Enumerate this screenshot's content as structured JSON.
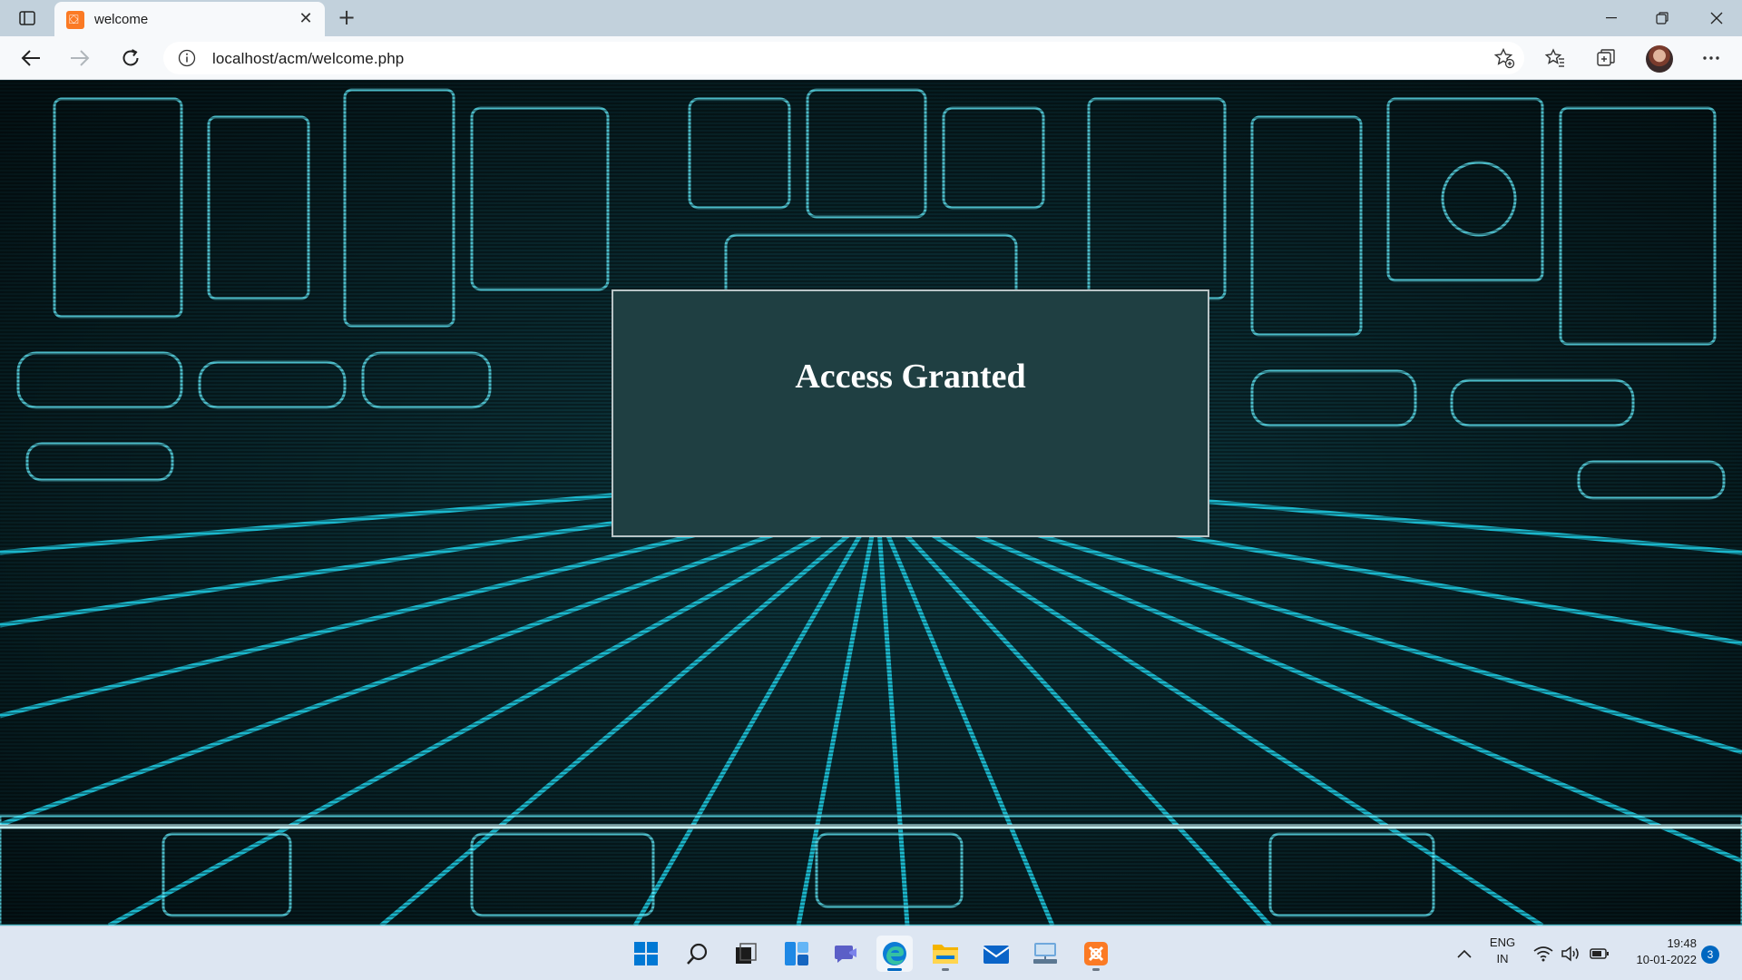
{
  "browser": {
    "tab": {
      "title": "welcome",
      "close_glyph": "✕"
    },
    "new_tab_glyph": "+",
    "address": {
      "url": "localhost/acm/welcome.php"
    },
    "accent_color": "#0067c0"
  },
  "page": {
    "heading": "Access Granted",
    "card_color": "#1f3f42",
    "background_color": "#0aa6c2"
  },
  "taskbar": {
    "icons": [
      "start-icon",
      "search-icon",
      "task-view-icon",
      "widgets-icon",
      "chat-icon",
      "edge-icon",
      "file-explorer-icon",
      "mail-icon",
      "network-app-icon",
      "xampp-icon"
    ],
    "tray": {
      "language": "ENG",
      "region": "IN",
      "time": "19:48",
      "date": "10-01-2022",
      "notification_count": "3"
    }
  }
}
